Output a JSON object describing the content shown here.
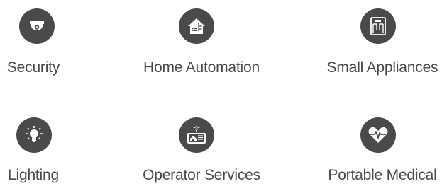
{
  "colors": {
    "icon_background": "#4a4a4a",
    "icon_foreground": "#ffffff",
    "label_text": "#4a4a4a",
    "page_background": "#ffffff"
  },
  "categories": [
    {
      "label": "Security",
      "icon": "security-camera-icon"
    },
    {
      "label": "Home Automation",
      "icon": "smart-home-icon"
    },
    {
      "label": "Small Appliances",
      "icon": "scale-appliance-icon"
    },
    {
      "label": "Lighting",
      "icon": "light-bulb-icon"
    },
    {
      "label": "Operator Services",
      "icon": "wireless-terminal-icon"
    },
    {
      "label": "Portable Medical",
      "icon": "heartbeat-icon"
    }
  ]
}
